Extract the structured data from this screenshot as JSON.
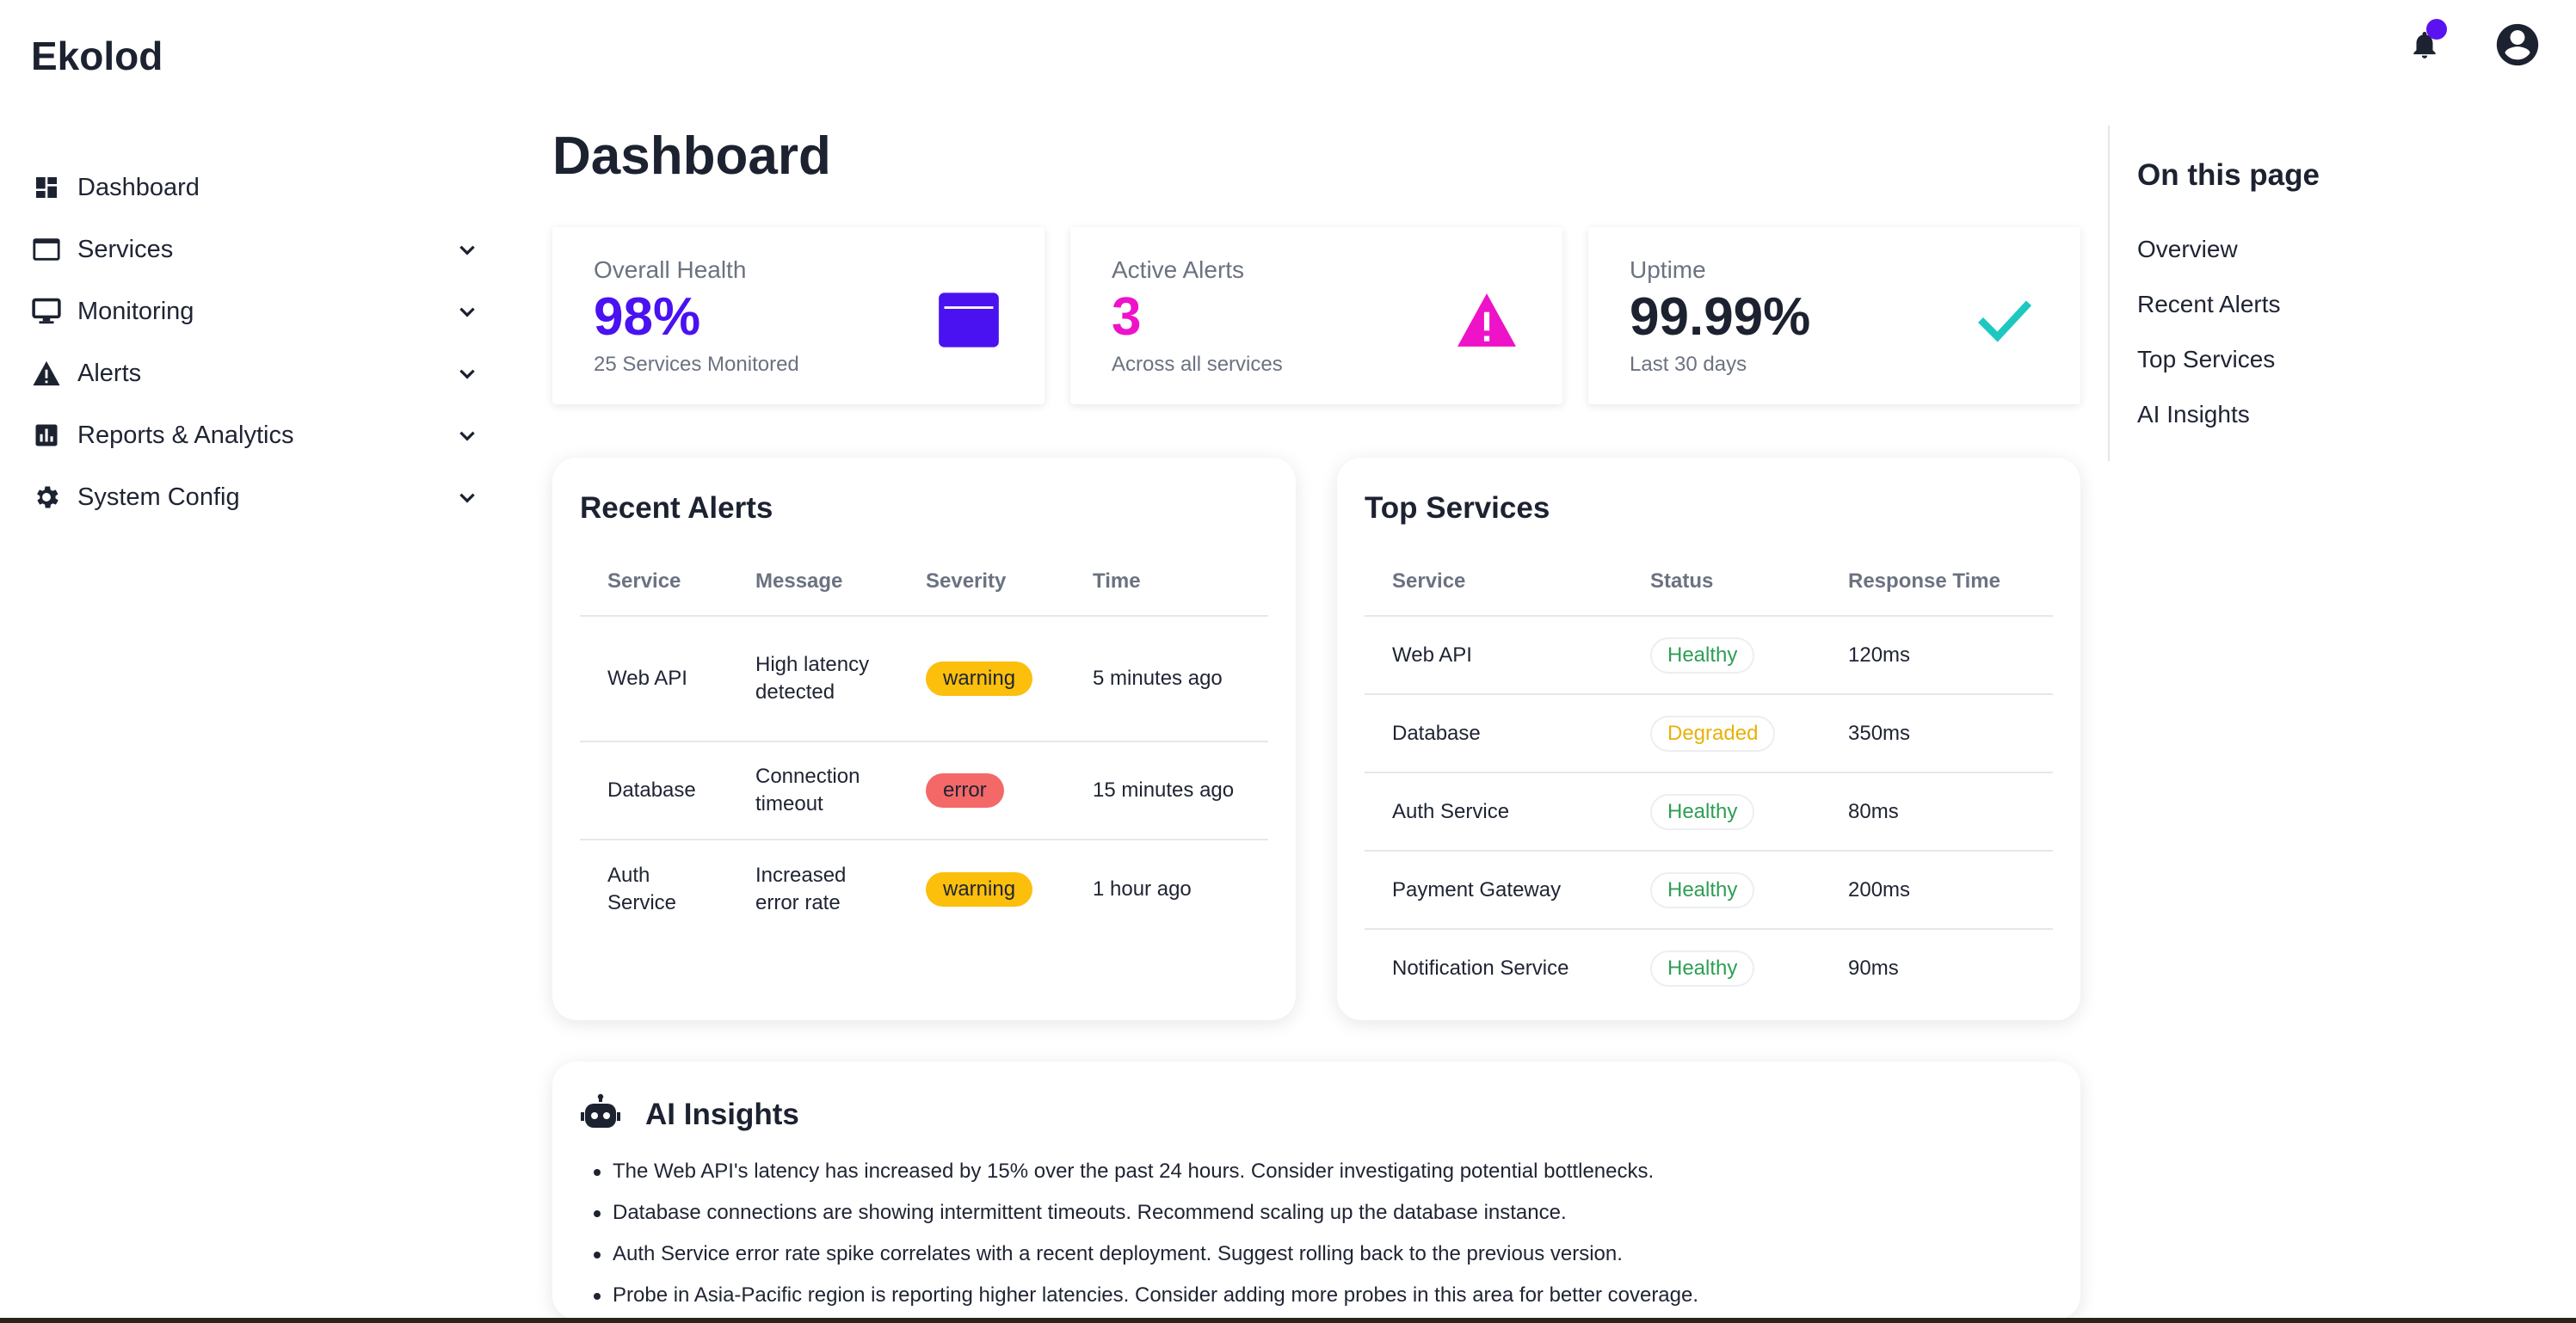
{
  "app": {
    "brand": "Ekolod"
  },
  "header": {
    "notifications_icon": "bell-icon",
    "profile_icon": "account-circle-icon",
    "accent": "#5b12f0"
  },
  "sidebar": {
    "items": [
      {
        "label": "Dashboard",
        "icon": "dashboard-icon",
        "expandable": false
      },
      {
        "label": "Services",
        "icon": "services-icon",
        "expandable": true
      },
      {
        "label": "Monitoring",
        "icon": "monitor-icon",
        "expandable": true
      },
      {
        "label": "Alerts",
        "icon": "warning-icon",
        "expandable": true
      },
      {
        "label": "Reports & Analytics",
        "icon": "analytics-icon",
        "expandable": true
      },
      {
        "label": "System Config",
        "icon": "gear-icon",
        "expandable": true
      }
    ]
  },
  "main": {
    "title": "Dashboard",
    "stats": [
      {
        "label": "Overall Health",
        "value": "98%",
        "sub": "25 Services Monitored",
        "color": "#4a12f0",
        "icon": "window-icon"
      },
      {
        "label": "Active Alerts",
        "value": "3",
        "sub": "Across all services",
        "color": "#ee12c9",
        "icon": "warning-icon"
      },
      {
        "label": "Uptime",
        "value": "99.99%",
        "sub": "Last 30 days",
        "color": "#1c2230",
        "icon": "check-icon",
        "icon_color": "#1ec8c0"
      }
    ],
    "recent_alerts": {
      "title": "Recent Alerts",
      "headers": [
        "Service",
        "Message",
        "Severity",
        "Time"
      ],
      "rows": [
        {
          "service": "Web API",
          "message": "High latency detected",
          "severity": "warning",
          "time": "5 minutes ago"
        },
        {
          "service": "Database",
          "message": "Connection timeout",
          "severity": "error",
          "time": "15 minutes ago"
        },
        {
          "service": "Auth Service",
          "message": "Increased error rate",
          "severity": "warning",
          "time": "1 hour ago"
        }
      ]
    },
    "top_services": {
      "title": "Top Services",
      "headers": [
        "Service",
        "Status",
        "Response Time"
      ],
      "rows": [
        {
          "service": "Web API",
          "status": "Healthy",
          "response": "120ms"
        },
        {
          "service": "Database",
          "status": "Degraded",
          "response": "350ms"
        },
        {
          "service": "Auth Service",
          "status": "Healthy",
          "response": "80ms"
        },
        {
          "service": "Payment Gateway",
          "status": "Healthy",
          "response": "200ms"
        },
        {
          "service": "Notification Service",
          "status": "Healthy",
          "response": "90ms"
        }
      ]
    },
    "ai_insights": {
      "title": "AI Insights",
      "icon": "robot-icon",
      "items": [
        "The Web API's latency has increased by 15% over the past 24 hours. Consider investigating potential bottlenecks.",
        "Database connections are showing intermittent timeouts. Recommend scaling up the database instance.",
        "Auth Service error rate spike correlates with a recent deployment. Suggest rolling back to the previous version.",
        "Probe in Asia-Pacific region is reporting higher latencies. Consider adding more probes in this area for better coverage."
      ]
    }
  },
  "toc": {
    "title": "On this page",
    "links": [
      "Overview",
      "Recent Alerts",
      "Top Services",
      "AI Insights"
    ]
  }
}
